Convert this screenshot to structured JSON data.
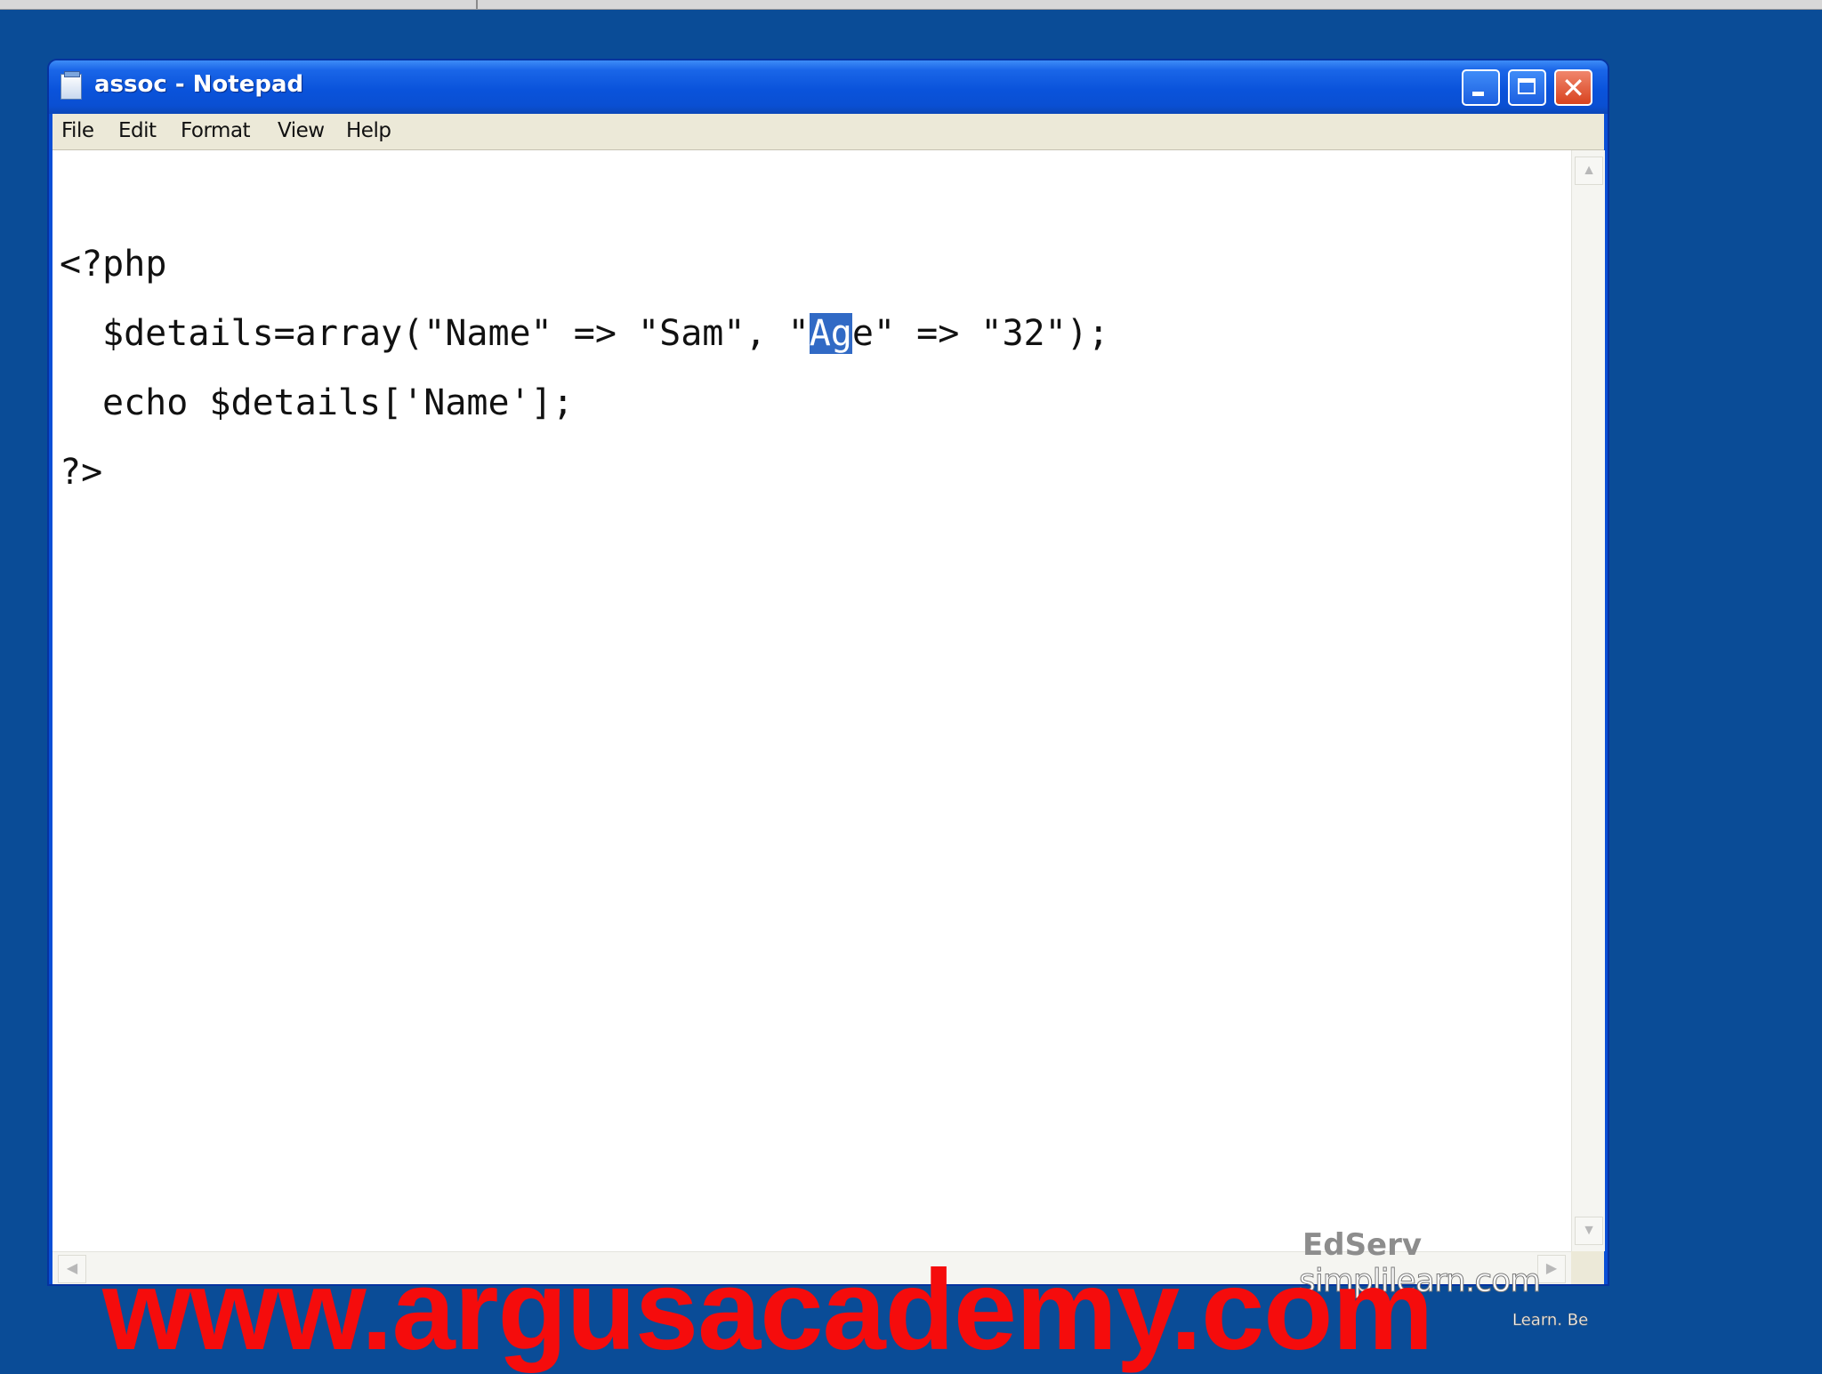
{
  "window": {
    "title": "assoc - Notepad"
  },
  "menubar": {
    "file": "File",
    "edit": "Edit",
    "format": "Format",
    "view": "View",
    "help": "Help"
  },
  "editor": {
    "line1": "<?php",
    "line2_prefix": "$details=array(\"Name\" => \"Sam\", \"",
    "line2_selected": "Ag",
    "line2_suffix": "e\" => \"32\");",
    "line3": "echo $details['Name'];",
    "line4": "?>"
  },
  "logo": {
    "top": "EdServ",
    "mid": "simplilearn.com",
    "bottom": "Learn. Be"
  },
  "watermark": {
    "text": "www.argusacademy.com"
  },
  "colors": {
    "desktop": "#0a4c97",
    "titlebar": "#0a53db",
    "selection": "#316ac5",
    "watermark": "#f50c0c"
  }
}
